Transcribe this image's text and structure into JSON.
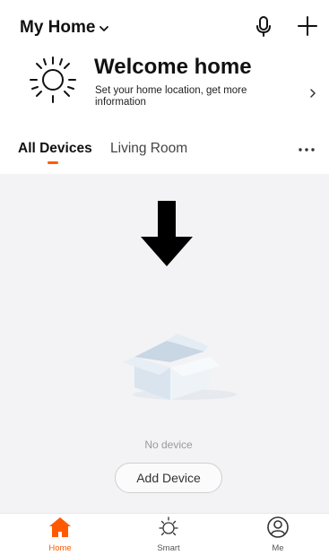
{
  "header": {
    "home_name": "My Home",
    "icons": {
      "dropdown": "chevron-down-icon",
      "voice": "microphone-icon",
      "add": "plus-icon"
    }
  },
  "welcome": {
    "title": "Welcome home",
    "subtitle": "Set your home location, get more information",
    "icon": "sun-icon",
    "arrow": "chevron-right-icon"
  },
  "tabs": [
    {
      "label": "All Devices",
      "active": true
    },
    {
      "label": "Living Room",
      "active": false
    }
  ],
  "tabs_more_icon": "more-horizontal-icon",
  "annotation_icon": "arrow-down-icon",
  "empty_state": {
    "illustration": "empty-box-illustration",
    "message": "No device",
    "button_label": "Add Device"
  },
  "bottom_nav": [
    {
      "label": "Home",
      "icon": "home-icon",
      "active": true
    },
    {
      "label": "Smart",
      "icon": "sun-outline-icon",
      "active": false
    },
    {
      "label": "Me",
      "icon": "user-icon",
      "active": false
    }
  ],
  "colors": {
    "accent": "#ff5a00",
    "background": "#ffffff",
    "content_background": "#f3f3f5",
    "text_primary": "#111111",
    "text_muted": "#9a9a9a"
  }
}
